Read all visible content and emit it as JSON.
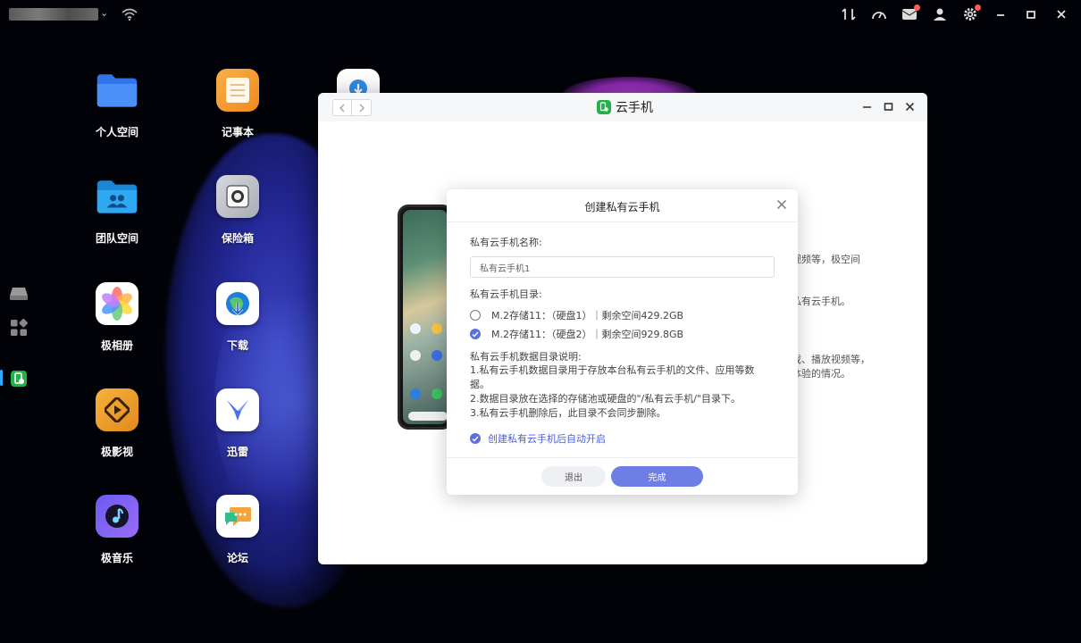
{
  "topbar": {
    "account_caret": "⌄",
    "icons": [
      "transfer-icon",
      "speed-gauge-icon",
      "mail-icon",
      "user-icon",
      "settings-icon",
      "minimize-icon",
      "restore-icon",
      "close-icon"
    ]
  },
  "desktop": {
    "icons": [
      {
        "label": "个人空间",
        "icon": "folder-icon",
        "color": "#3d8bf7"
      },
      {
        "label": "团队空间",
        "icon": "team-folder-icon",
        "color": "#2a9cf0"
      },
      {
        "label": "极相册",
        "icon": "photos-icon",
        "color": "#ffffff"
      },
      {
        "label": "极影视",
        "icon": "video-icon",
        "color": "#f0a030"
      },
      {
        "label": "极音乐",
        "icon": "music-icon",
        "color": "#7a66f0"
      },
      {
        "label": "记事本",
        "icon": "notepad-icon",
        "color": "#f6a23a"
      },
      {
        "label": "保险箱",
        "icon": "safe-icon",
        "color": "#c9ccd2"
      },
      {
        "label": "下载",
        "icon": "download-globe-icon",
        "color": "#ffffff"
      },
      {
        "label": "迅雷",
        "icon": "thunder-icon",
        "color": "#ffffff"
      },
      {
        "label": "论坛",
        "icon": "forum-icon",
        "color": "#ffffff"
      }
    ]
  },
  "window": {
    "title": "云手机",
    "background_text": {
      "line1": "视频等，极空间",
      "line2": "私有云手机。",
      "line3": "。",
      "line4": "戏、播放视频等，",
      "line5": "体验的情况。"
    }
  },
  "modal": {
    "title": "创建私有云手机",
    "name_label": "私有云手机名称:",
    "name_value": "私有云手机1",
    "dir_label": "私有云手机目录:",
    "options": [
      {
        "text": "M.2存储11：（硬盘1）｜剩余空间429.2GB",
        "selected": false
      },
      {
        "text": "M.2存储11：（硬盘2）｜剩余空间929.8GB",
        "selected": true
      }
    ],
    "desc_title": "私有云手机数据目录说明:",
    "desc_lines": [
      "1.私有云手机数据目录用于存放本台私有云手机的文件、应用等数据。",
      "2.数据目录放在选择的存储池或硬盘的\"/私有云手机/\"目录下。",
      "3.私有云手机删除后，此目录不会同步删除。"
    ],
    "auto_start_label": "创建私有云手机后自动开启",
    "cancel_label": "退出",
    "confirm_label": "完成"
  },
  "colors": {
    "accent": "#6d7ee6",
    "app_green": "#27b04a",
    "notify_red": "#ff5b5b"
  }
}
